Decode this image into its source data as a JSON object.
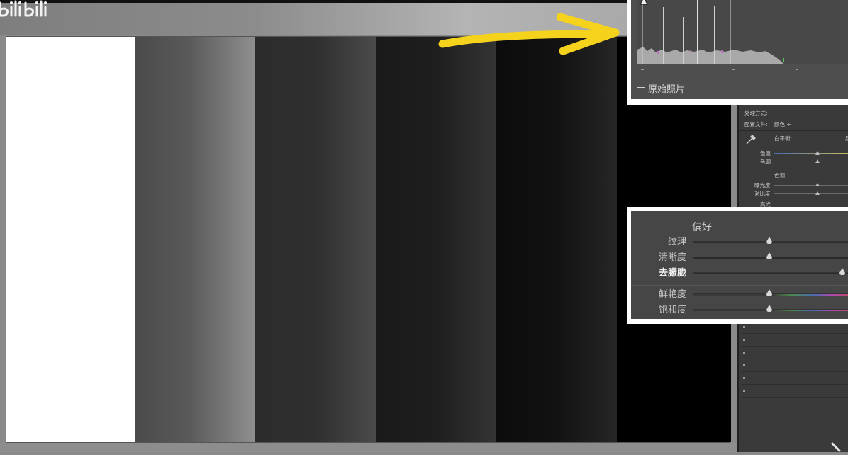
{
  "watermark": {
    "logo_text": "bilibili"
  },
  "develop_panel": {
    "treatment_label": "处理方式:",
    "profile_label": "配置文件:",
    "profile_value": "颜色 ÷",
    "white_balance_label": "白平衡:",
    "white_balance_value_fragment": "原",
    "temp_label": "色温",
    "tint_label": "色调",
    "tone_header": "色调",
    "exposure_label": "曝光度",
    "contrast_label": "对比度",
    "highlights_label": "高光"
  },
  "histogram": {
    "original_photo_label": "原始照片"
  },
  "presence": {
    "title": "偏好",
    "sliders": [
      {
        "label": "纹理",
        "value": 0.5
      },
      {
        "label": "清晰度",
        "value": 0.5
      },
      {
        "label": "去朦胧",
        "value": 0.98
      },
      {
        "label": "鲜艳度",
        "value": 0.5
      },
      {
        "label": "饱和度",
        "value": 0.5
      }
    ]
  },
  "colors": {
    "annotation_arrow": "#f5d21c",
    "callout_border": "#ffffff",
    "panel_bg": "#3a3a3a"
  }
}
